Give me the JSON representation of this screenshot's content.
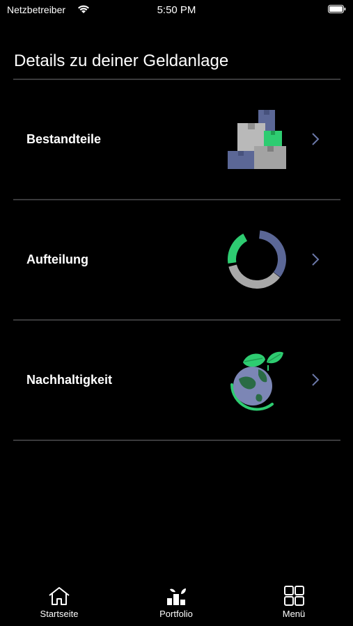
{
  "status": {
    "carrier": "Netzbetreiber",
    "time": "5:50 PM"
  },
  "page": {
    "title": "Details zu deiner Geldanlage"
  },
  "rows": [
    {
      "label": "Bestandteile",
      "icon": "boxes-icon"
    },
    {
      "label": "Aufteilung",
      "icon": "donut-chart-icon"
    },
    {
      "label": "Nachhaltigkeit",
      "icon": "globe-leaf-icon"
    }
  ],
  "tabbar": {
    "items": [
      {
        "label": "Startseite",
        "icon": "home-icon"
      },
      {
        "label": "Portfolio",
        "icon": "portfolio-icon"
      },
      {
        "label": "Menü",
        "icon": "grid-icon"
      }
    ]
  },
  "colors": {
    "accent": "#2ecc71",
    "slate": "#5b6796",
    "grey": "#a8a8a8",
    "chevron": "#6b78a8"
  }
}
